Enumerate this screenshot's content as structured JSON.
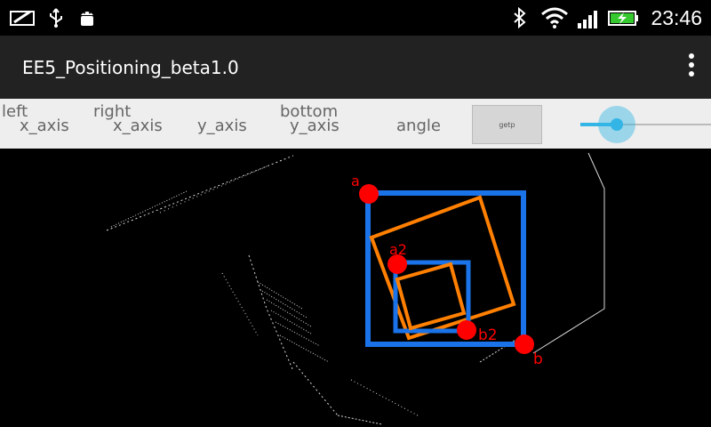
{
  "status_bar": {
    "time": "23:46",
    "icons": [
      "screenshot-icon",
      "usb-icon",
      "android-debug-icon",
      "bluetooth-icon",
      "wifi-icon",
      "signal-icon",
      "battery-charging-icon"
    ]
  },
  "action_bar": {
    "title": "EE5_Positioning_beta1.0",
    "overflow_icon": "overflow-menu-icon"
  },
  "controls": {
    "left_label": "left",
    "left_x_axis": "x_axis",
    "right_label": "right",
    "right_x_axis": "x_axis",
    "y_axis": "y_axis",
    "bottom_label": "bottom",
    "bottom_y_axis": "y_axis",
    "angle": "angle",
    "getp_button": "getp",
    "slider_value": 0.2
  },
  "camera": {
    "markers": {
      "a": "a",
      "a2": "a2",
      "b2": "b2",
      "b": "b"
    },
    "colors": {
      "bounding_box": "#1a73e8",
      "rotated_box": "#ff8000",
      "marker": "#ff0000",
      "edges": "#ffffff"
    }
  }
}
